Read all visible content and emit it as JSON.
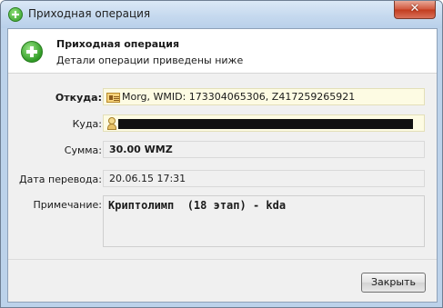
{
  "window": {
    "title": "Приходная операция"
  },
  "header": {
    "title": "Приходная операция",
    "subtitle": "Детали операции приведены ниже"
  },
  "fields": {
    "from": {
      "label": "Откуда:",
      "value": "Morg, WMID: 173304065306, Z417259265921"
    },
    "to": {
      "label": "Куда:",
      "value": ""
    },
    "amount": {
      "label": "Сумма:",
      "value": "30.00 WMZ"
    },
    "date": {
      "label": "Дата перевода:",
      "value": "20.06.15 17:31"
    },
    "note": {
      "label": "Примечание:",
      "value": "Криптолимп  (18 этап) - kda"
    }
  },
  "buttons": {
    "close": "Закрыть"
  },
  "icons": {
    "title": "add-green-icon",
    "header": "add-green-icon",
    "from": "contact-card-icon",
    "to": "user-icon"
  },
  "colors": {
    "accent_green": "#2f9a25",
    "highlight_field": "#fdfbe3",
    "close_red": "#c23b1e"
  }
}
